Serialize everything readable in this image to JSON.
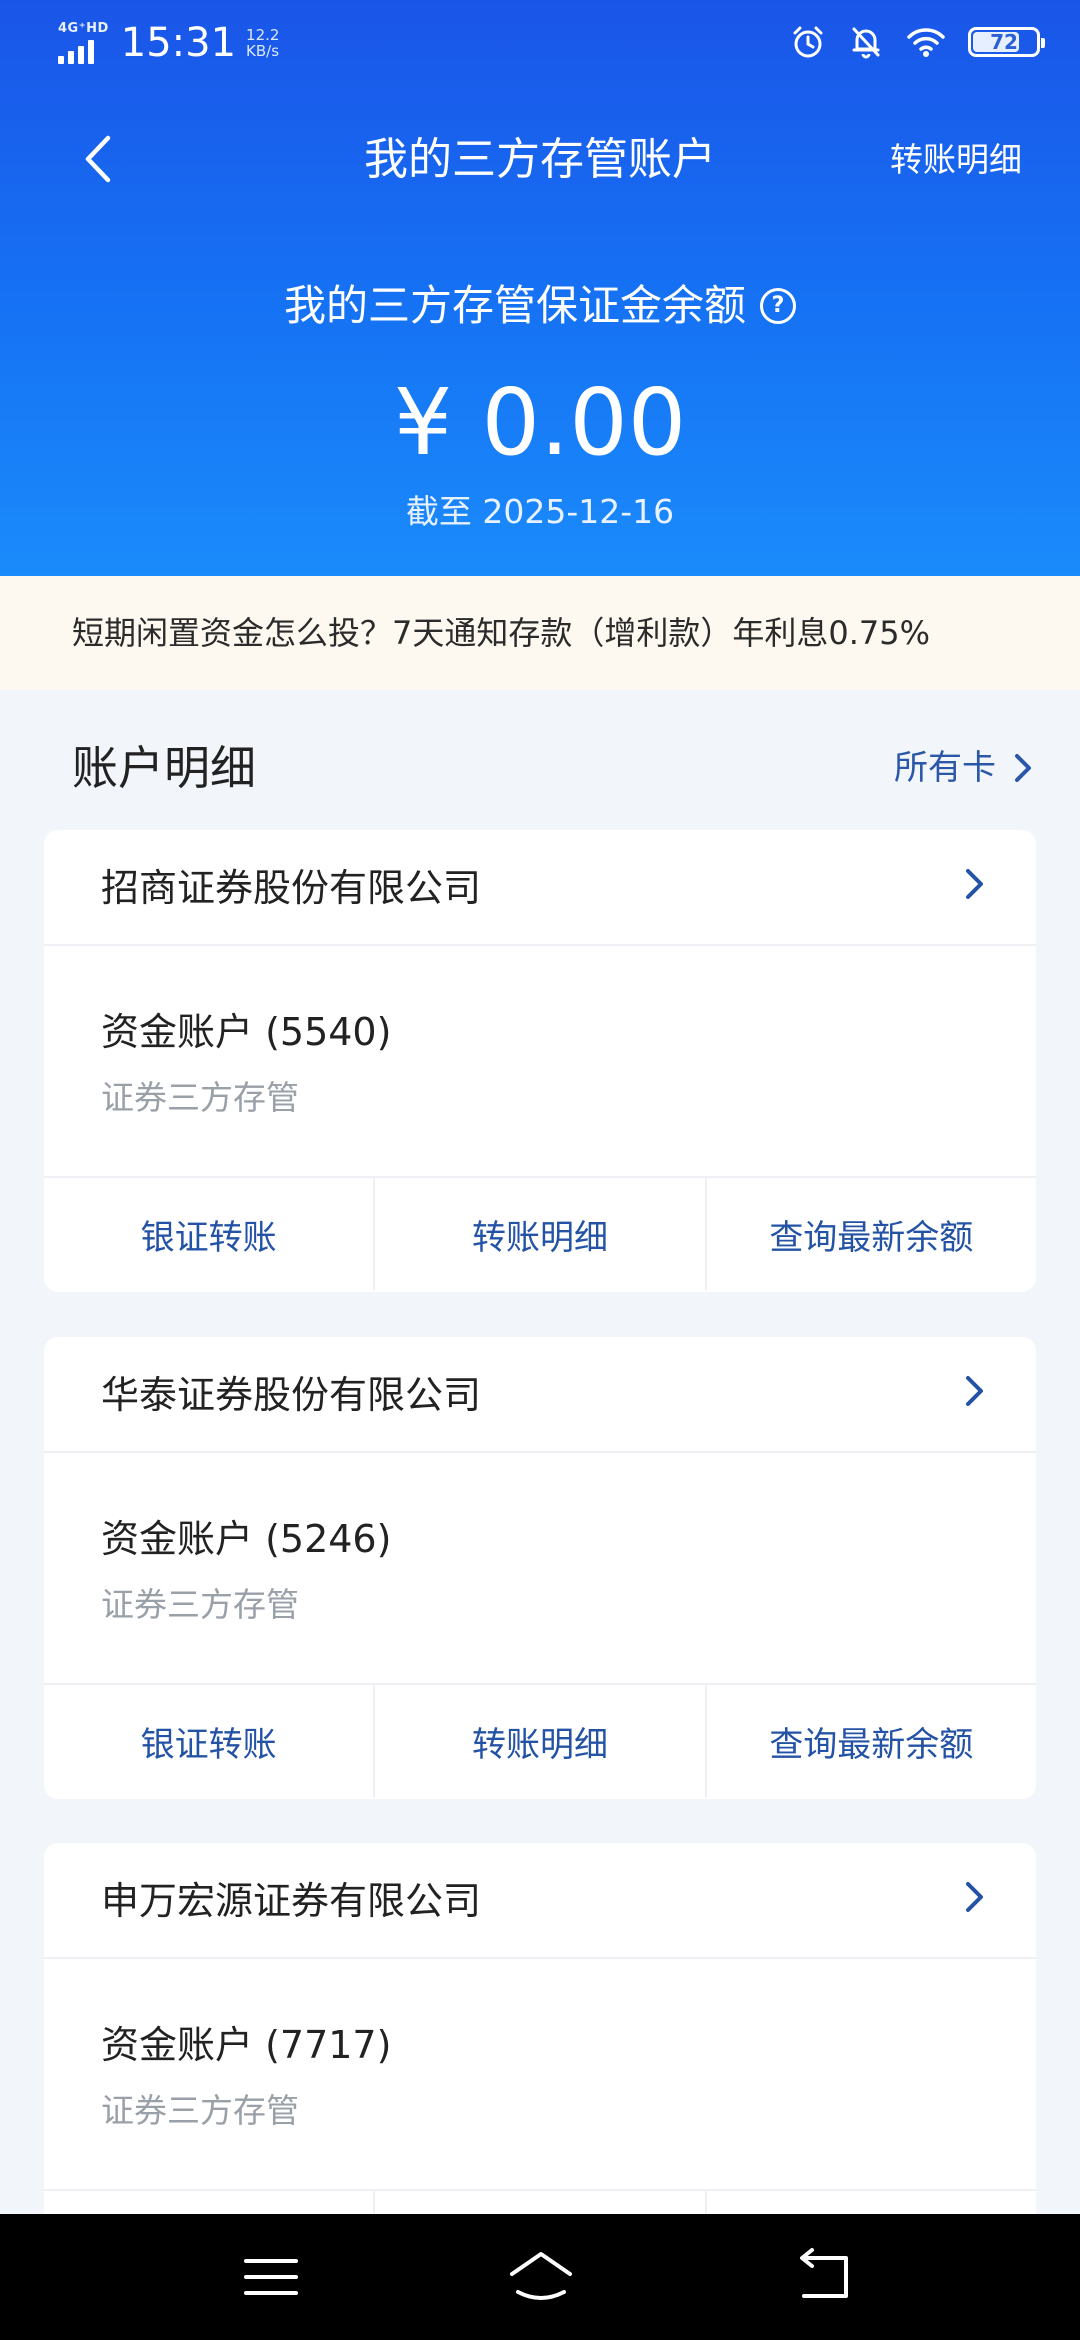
{
  "status_bar": {
    "network_tag": "4G⁺HD",
    "time": "15:31",
    "net_speed_value": "12.2",
    "net_speed_unit": "KB/s",
    "battery_level": "72",
    "icons": [
      "alarm-icon",
      "bell-muted-icon",
      "wifi-icon",
      "battery-icon"
    ]
  },
  "navbar": {
    "title": "我的三方存管账户",
    "right_link": "转账明细",
    "back_icon": "chevron-left-icon"
  },
  "balance": {
    "label": "我的三方存管保证金余额",
    "help_glyph": "?",
    "value": "¥ 0.00",
    "as_of": "截至 2025-12-16"
  },
  "promo": {
    "text": "短期闲置资金怎么投？7天通知存款（增利款）年利息0.75%"
  },
  "accounts_section": {
    "title": "账户明细",
    "link": "所有卡"
  },
  "cards": [
    {
      "company": "招商证券股份有限公司",
      "account": "资金账户 (5540)",
      "account_type": "证券三方存管",
      "actions": [
        "银证转账",
        "转账明细",
        "查询最新余额"
      ]
    },
    {
      "company": "华泰证券股份有限公司",
      "account": "资金账户 (5246)",
      "account_type": "证券三方存管",
      "actions": [
        "银证转账",
        "转账明细",
        "查询最新余额"
      ]
    },
    {
      "company": "申万宏源证券有限公司",
      "account": "资金账户 (7717)",
      "account_type": "证券三方存管",
      "actions": []
    }
  ],
  "system_nav": {
    "icons": [
      "menu-icon",
      "home-icon",
      "back-icon"
    ]
  },
  "colors": {
    "header_blue": "#1a6af2",
    "link_blue": "#2453a6",
    "promo_bg": "#fdf8f0",
    "page_bg": "#f2f6fb"
  }
}
